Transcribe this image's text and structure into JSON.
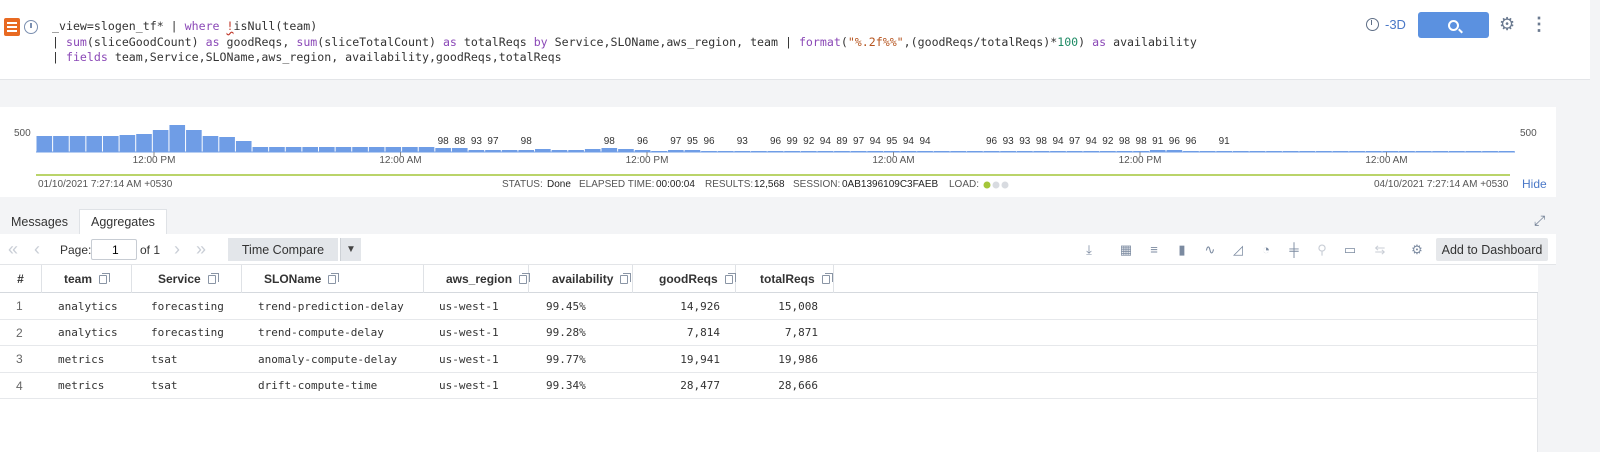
{
  "query": {
    "line1_a": "_view=slogen_tf* | ",
    "line1_kw": "where",
    "line1_bang": "!",
    "line1_b": "isNull(team)",
    "line2_a": "| ",
    "line2_sum1": "sum",
    "line2_b": "(sliceGoodCount) ",
    "line2_as1": "as",
    "line2_c": " goodReqs, ",
    "line2_sum2": "sum",
    "line2_d": "(sliceTotalCount) ",
    "line2_as2": "as",
    "line2_e": " totalReqs ",
    "line2_by": "by",
    "line2_f": " Service,SLOName,aws_region, team | ",
    "line2_format": "format",
    "line2_g": "(",
    "line2_str": "\"%.2f%%\"",
    "line2_h": ",(goodReqs/totalReqs)*",
    "line2_num": "100",
    "line2_i": ") ",
    "line2_as3": "as",
    "line2_j": " availability",
    "line3_a": "| ",
    "line3_kw": "fields",
    "line3_b": " team,Service,SLOName,aws_region, availability,goodReqs,totalReqs"
  },
  "time_range": "-3D",
  "histogram": {
    "y_max_label": "500",
    "x_labels": [
      "12:00 PM",
      "12:00 AM",
      "12:00 PM",
      "12:00 AM",
      "12:00 PM",
      "12:00 AM"
    ],
    "bar_values": [
      16,
      16,
      16,
      16,
      16,
      17,
      18,
      22,
      27,
      22,
      16,
      15,
      11,
      5,
      5,
      5,
      5,
      5,
      5,
      5,
      5,
      5,
      5,
      5,
      4,
      4,
      2,
      2,
      2,
      2,
      3,
      2,
      2,
      3,
      4,
      3,
      2,
      1,
      2,
      2,
      1,
      1,
      1,
      1,
      1,
      1,
      1,
      1,
      1,
      1,
      1,
      1,
      1,
      1,
      1,
      1,
      1,
      1,
      1,
      1,
      1,
      1,
      1,
      1,
      1,
      1,
      1,
      2,
      2,
      1,
      1,
      1,
      1,
      1,
      1,
      1,
      1,
      1,
      1,
      1,
      1,
      1,
      1,
      1,
      1,
      1,
      1,
      1,
      1
    ],
    "count_labels": [
      {
        "bar": 24,
        "text": "98"
      },
      {
        "bar": 25,
        "text": "88"
      },
      {
        "bar": 26,
        "text": "93"
      },
      {
        "bar": 27,
        "text": "97"
      },
      {
        "bar": 29,
        "text": "98"
      },
      {
        "bar": 34,
        "text": "98"
      },
      {
        "bar": 36,
        "text": "96"
      },
      {
        "bar": 38,
        "text": "97"
      },
      {
        "bar": 39,
        "text": "95"
      },
      {
        "bar": 40,
        "text": "96"
      },
      {
        "bar": 42,
        "text": "93"
      },
      {
        "bar": 44,
        "text": "96"
      },
      {
        "bar": 45,
        "text": "99"
      },
      {
        "bar": 46,
        "text": "92"
      },
      {
        "bar": 47,
        "text": "94"
      },
      {
        "bar": 48,
        "text": "89"
      },
      {
        "bar": 49,
        "text": "97"
      },
      {
        "bar": 50,
        "text": "94"
      },
      {
        "bar": 51,
        "text": "95"
      },
      {
        "bar": 52,
        "text": "94"
      },
      {
        "bar": 53,
        "text": "94"
      },
      {
        "bar": 57,
        "text": "96"
      },
      {
        "bar": 58,
        "text": "93"
      },
      {
        "bar": 59,
        "text": "93"
      },
      {
        "bar": 60,
        "text": "98"
      },
      {
        "bar": 61,
        "text": "94"
      },
      {
        "bar": 62,
        "text": "97"
      },
      {
        "bar": 63,
        "text": "94"
      },
      {
        "bar": 64,
        "text": "92"
      },
      {
        "bar": 65,
        "text": "98"
      },
      {
        "bar": 66,
        "text": "98"
      },
      {
        "bar": 67,
        "text": "91"
      },
      {
        "bar": 68,
        "text": "96"
      },
      {
        "bar": 69,
        "text": "96"
      },
      {
        "bar": 71,
        "text": "91"
      }
    ],
    "bar_color": "#6f9de6",
    "start_time": "01/10/2021 7:27:14 AM +0530",
    "end_time": "04/10/2021 7:27:14 AM +0530",
    "status_label": "STATUS:",
    "status_value": "Done",
    "elapsed_label": "ELAPSED TIME:",
    "elapsed_value": "00:00:04",
    "results_label": "RESULTS:",
    "results_value": "12,568",
    "session_label": "SESSION:",
    "session_value": "0AB1396109C3FAEB",
    "load_label": "LOAD:",
    "hide_label": "Hide"
  },
  "tabs": [
    {
      "label": "Messages"
    },
    {
      "label": "Aggregates"
    }
  ],
  "toolbar": {
    "page_label": "Page:",
    "page_value": "1",
    "of_label": "of 1",
    "time_compare_label": "Time Compare",
    "add_dashboard_label": "Add to Dashboard"
  },
  "table": {
    "columns": [
      "#",
      "team",
      "Service",
      "SLOName",
      "aws_region",
      "availability",
      "goodReqs",
      "totalReqs"
    ],
    "rows": [
      [
        "1",
        "analytics",
        "forecasting",
        "trend-prediction-delay",
        "us-west-1",
        "99.45%",
        "14,926",
        "15,008"
      ],
      [
        "2",
        "analytics",
        "forecasting",
        "trend-compute-delay",
        "us-west-1",
        "99.28%",
        "7,814",
        "7,871"
      ],
      [
        "3",
        "metrics",
        "tsat",
        "anomaly-compute-delay",
        "us-west-1",
        "99.77%",
        "19,941",
        "19,986"
      ],
      [
        "4",
        "metrics",
        "tsat",
        "drift-compute-time",
        "us-west-1",
        "99.34%",
        "28,477",
        "28,666"
      ]
    ]
  }
}
